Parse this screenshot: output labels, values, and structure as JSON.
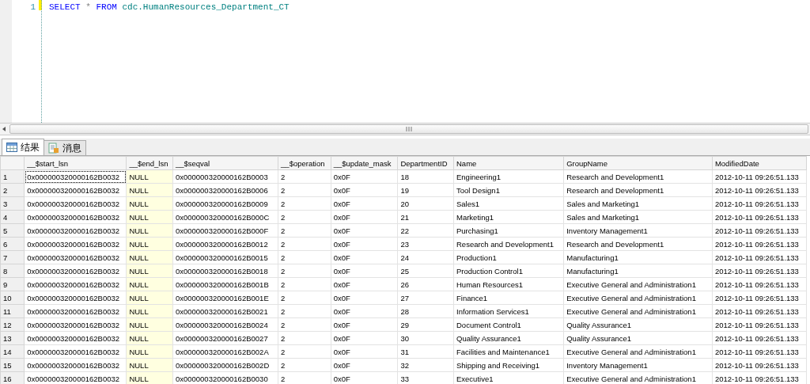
{
  "editor": {
    "line_number": "1",
    "code": [
      {
        "kind": "keyword",
        "text": "SELECT"
      },
      {
        "kind": "operator",
        "text": "*"
      },
      {
        "kind": "keyword",
        "text": "FROM"
      },
      {
        "kind": "identifier",
        "text": "cdc.HumanResources_Department_CT"
      }
    ]
  },
  "tabs": [
    {
      "label": "结果",
      "selected": true
    },
    {
      "label": "消息",
      "selected": false
    }
  ],
  "table": {
    "columns": [
      {
        "label": "__$start_lsn",
        "highlighted": false
      },
      {
        "label": "__$end_lsn",
        "highlighted": true
      },
      {
        "label": "__$seqval",
        "highlighted": false
      },
      {
        "label": "__$operation",
        "highlighted": false
      },
      {
        "label": "__$update_mask",
        "highlighted": false
      },
      {
        "label": "DepartmentID",
        "highlighted": false
      },
      {
        "label": "Name",
        "highlighted": false
      },
      {
        "label": "GroupName",
        "highlighted": false
      },
      {
        "label": "ModifiedDate",
        "highlighted": false
      }
    ],
    "rows": [
      {
        "number": "1",
        "focused": true,
        "cells": [
          "0x000000320000162B0032",
          "NULL",
          "0x000000320000162B0003",
          "2",
          "0x0F",
          "18",
          "Engineering1",
          "Research and Development1",
          "2012-10-11 09:26:51.133"
        ]
      },
      {
        "number": "2",
        "focused": false,
        "cells": [
          "0x000000320000162B0032",
          "NULL",
          "0x000000320000162B0006",
          "2",
          "0x0F",
          "19",
          "Tool Design1",
          "Research and Development1",
          "2012-10-11 09:26:51.133"
        ]
      },
      {
        "number": "3",
        "focused": false,
        "cells": [
          "0x000000320000162B0032",
          "NULL",
          "0x000000320000162B0009",
          "2",
          "0x0F",
          "20",
          "Sales1",
          "Sales and Marketing1",
          "2012-10-11 09:26:51.133"
        ]
      },
      {
        "number": "4",
        "focused": false,
        "cells": [
          "0x000000320000162B0032",
          "NULL",
          "0x000000320000162B000C",
          "2",
          "0x0F",
          "21",
          "Marketing1",
          "Sales and Marketing1",
          "2012-10-11 09:26:51.133"
        ]
      },
      {
        "number": "5",
        "focused": false,
        "cells": [
          "0x000000320000162B0032",
          "NULL",
          "0x000000320000162B000F",
          "2",
          "0x0F",
          "22",
          "Purchasing1",
          "Inventory Management1",
          "2012-10-11 09:26:51.133"
        ]
      },
      {
        "number": "6",
        "focused": false,
        "cells": [
          "0x000000320000162B0032",
          "NULL",
          "0x000000320000162B0012",
          "2",
          "0x0F",
          "23",
          "Research and Development1",
          "Research and Development1",
          "2012-10-11 09:26:51.133"
        ]
      },
      {
        "number": "7",
        "focused": false,
        "cells": [
          "0x000000320000162B0032",
          "NULL",
          "0x000000320000162B0015",
          "2",
          "0x0F",
          "24",
          "Production1",
          "Manufacturing1",
          "2012-10-11 09:26:51.133"
        ]
      },
      {
        "number": "8",
        "focused": false,
        "cells": [
          "0x000000320000162B0032",
          "NULL",
          "0x000000320000162B0018",
          "2",
          "0x0F",
          "25",
          "Production Control1",
          "Manufacturing1",
          "2012-10-11 09:26:51.133"
        ]
      },
      {
        "number": "9",
        "focused": false,
        "cells": [
          "0x000000320000162B0032",
          "NULL",
          "0x000000320000162B001B",
          "2",
          "0x0F",
          "26",
          "Human Resources1",
          "Executive General and Administration1",
          "2012-10-11 09:26:51.133"
        ]
      },
      {
        "number": "10",
        "focused": false,
        "cells": [
          "0x000000320000162B0032",
          "NULL",
          "0x000000320000162B001E",
          "2",
          "0x0F",
          "27",
          "Finance1",
          "Executive General and Administration1",
          "2012-10-11 09:26:51.133"
        ]
      },
      {
        "number": "11",
        "focused": false,
        "cells": [
          "0x000000320000162B0032",
          "NULL",
          "0x000000320000162B0021",
          "2",
          "0x0F",
          "28",
          "Information Services1",
          "Executive General and Administration1",
          "2012-10-11 09:26:51.133"
        ]
      },
      {
        "number": "12",
        "focused": false,
        "cells": [
          "0x000000320000162B0032",
          "NULL",
          "0x000000320000162B0024",
          "2",
          "0x0F",
          "29",
          "Document Control1",
          "Quality Assurance1",
          "2012-10-11 09:26:51.133"
        ]
      },
      {
        "number": "13",
        "focused": false,
        "cells": [
          "0x000000320000162B0032",
          "NULL",
          "0x000000320000162B0027",
          "2",
          "0x0F",
          "30",
          "Quality Assurance1",
          "Quality Assurance1",
          "2012-10-11 09:26:51.133"
        ]
      },
      {
        "number": "14",
        "focused": false,
        "cells": [
          "0x000000320000162B0032",
          "NULL",
          "0x000000320000162B002A",
          "2",
          "0x0F",
          "31",
          "Facilities and Maintenance1",
          "Executive General and Administration1",
          "2012-10-11 09:26:51.133"
        ]
      },
      {
        "number": "15",
        "focused": false,
        "cells": [
          "0x000000320000162B0032",
          "NULL",
          "0x000000320000162B002D",
          "2",
          "0x0F",
          "32",
          "Shipping and Receiving1",
          "Inventory Management1",
          "2012-10-11 09:26:51.133"
        ]
      },
      {
        "number": "16",
        "focused": false,
        "cells": [
          "0x000000320000162B0032",
          "NULL",
          "0x000000320000162B0030",
          "2",
          "0x0F",
          "33",
          "Executive1",
          "Executive General and Administration1",
          "2012-10-11 09:26:51.133"
        ]
      }
    ]
  }
}
